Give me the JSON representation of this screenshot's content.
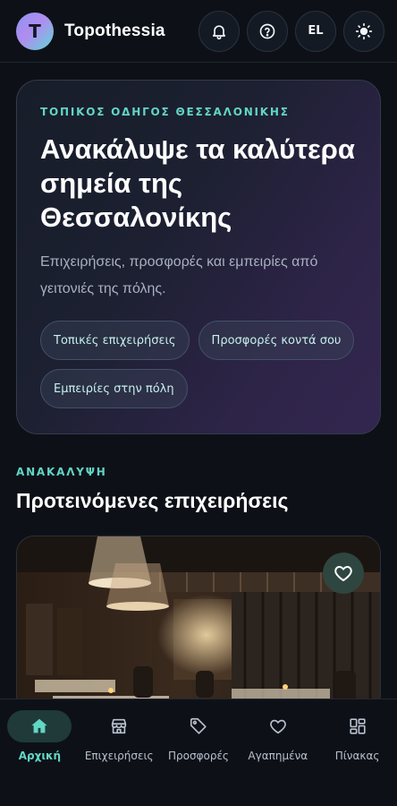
{
  "header": {
    "avatar_letter": "T",
    "brand": "Topothessia",
    "language": "EL",
    "icons": [
      "bell-icon",
      "help-icon",
      "sun-icon"
    ]
  },
  "hero": {
    "eyebrow": "ΤΟΠΙΚΟΣ ΟΔΗΓΟΣ ΘΕΣΣΑΛΟΝΙΚΗΣ",
    "title": "Ανακάλυψε τα καλύτερα σημεία της Θεσσαλονίκης",
    "subtitle": "Επιχειρήσεις, προσφορές και εμπειρίες από γειτονιές της πόλης.",
    "chips": [
      "Τοπικές επιχειρήσεις",
      "Προσφορές κοντά σου",
      "Εμπειρίες στην πόλη"
    ]
  },
  "discovery": {
    "eyebrow": "ΑΝΑΚΑΛΥΨΗ",
    "title": "Προτεινόμενες επιχειρήσεις",
    "card_icon": "heart-icon"
  },
  "nav": {
    "items": [
      {
        "label": "Αρχική",
        "icon": "home-icon",
        "active": true
      },
      {
        "label": "Επιχειρήσεις",
        "icon": "store-icon",
        "active": false
      },
      {
        "label": "Προσφορές",
        "icon": "tag-icon",
        "active": false
      },
      {
        "label": "Αγαπημένα",
        "icon": "heart-icon",
        "active": false
      },
      {
        "label": "Πίνακας",
        "icon": "dashboard-icon",
        "active": false
      }
    ]
  },
  "colors": {
    "accent": "#62d5c5",
    "background": "#0d1117"
  }
}
